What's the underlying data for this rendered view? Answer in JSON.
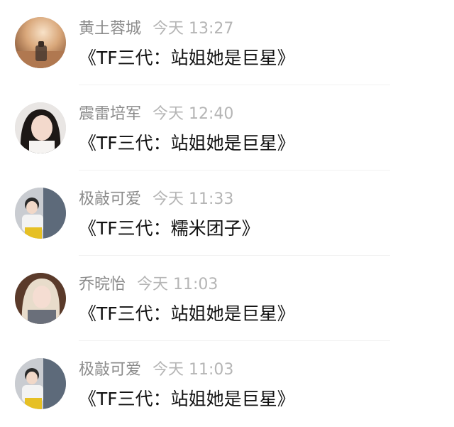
{
  "messages": [
    {
      "username": "黄土蓉城",
      "time": "今天 13:27",
      "text": "《TF三代：站姐她是巨星》",
      "avatar_icon": "sunset-bottle-avatar"
    },
    {
      "username": "震雷培军",
      "time": "今天 12:40",
      "text": "《TF三代：站姐她是巨星》",
      "avatar_icon": "girl-portrait-avatar"
    },
    {
      "username": "极敲可爱",
      "time": "今天 11:33",
      "text": "《TF三代：糯米团子》",
      "avatar_icon": "boy-photo-avatar"
    },
    {
      "username": "乔晥怡",
      "time": "今天 11:03",
      "text": "《TF三代：站姐她是巨星》",
      "avatar_icon": "blonde-girl-avatar"
    },
    {
      "username": "极敲可爱",
      "time": "今天 11:03",
      "text": "《TF三代：站姐她是巨星》",
      "avatar_icon": "boy-photo-avatar"
    }
  ]
}
